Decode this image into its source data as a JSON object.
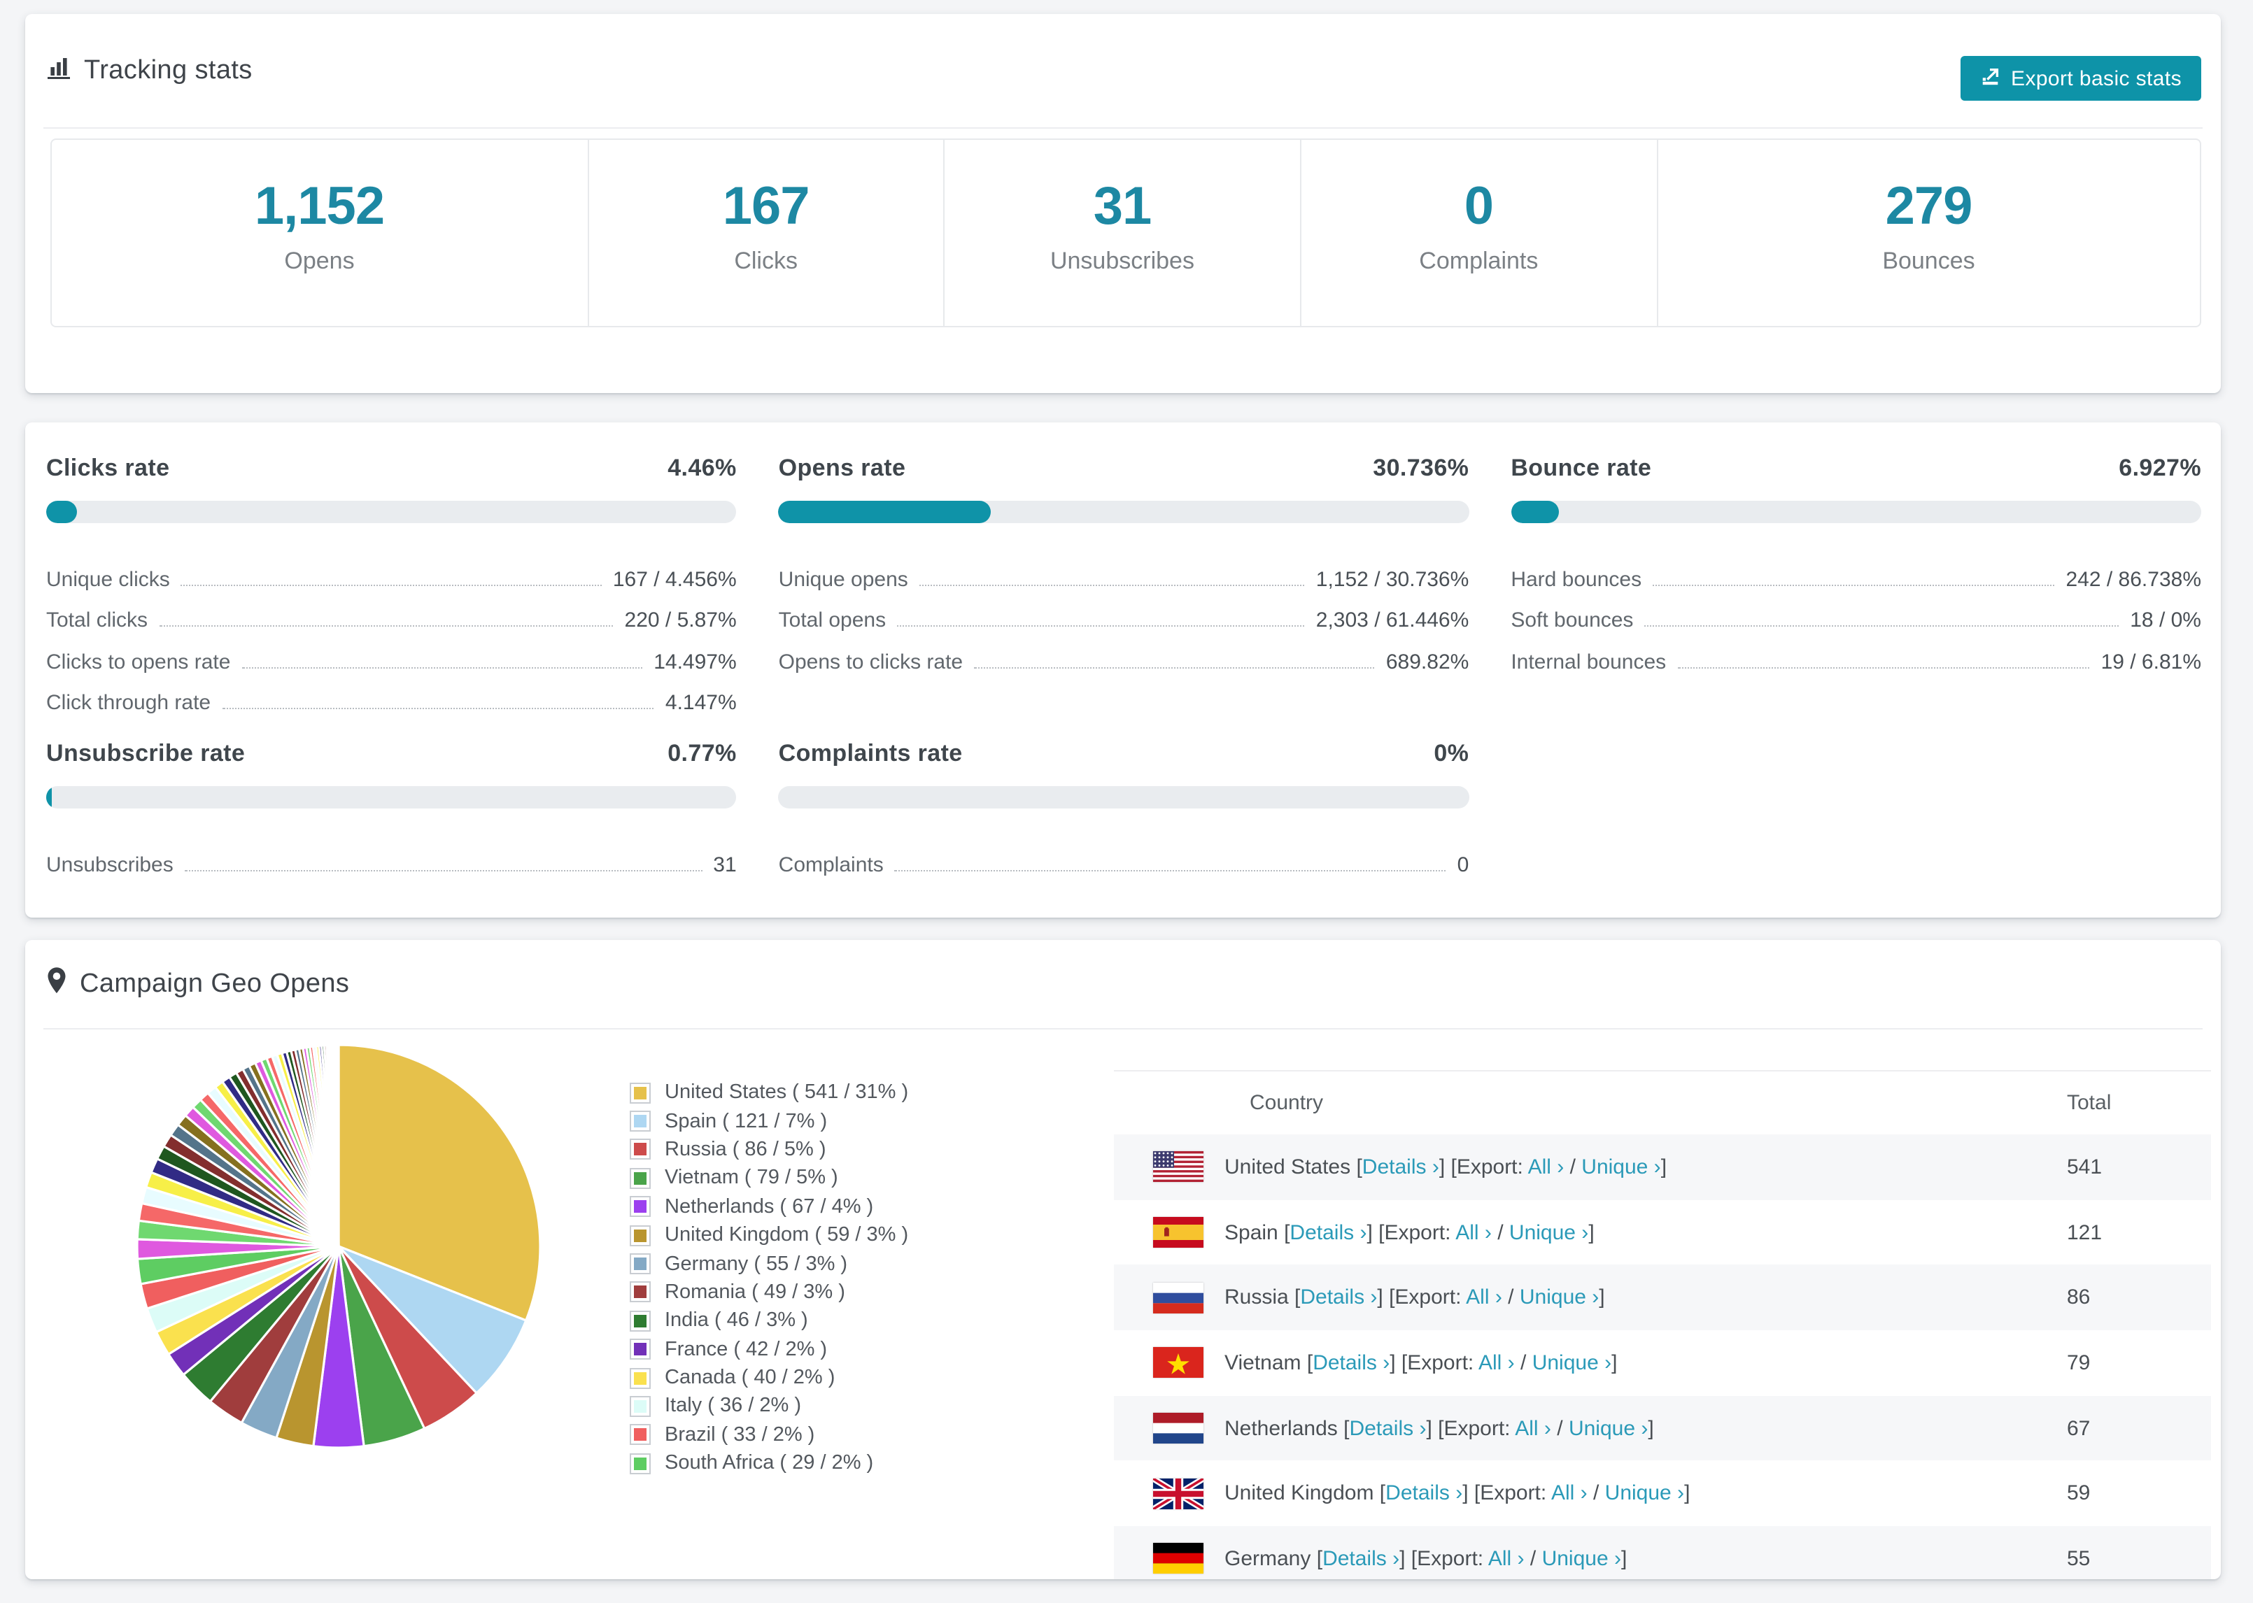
{
  "colors": {
    "page_bg": "#f4f5f7",
    "accent_number": "#1d88a3",
    "button_teal": "#0e93a8",
    "bar_fill": "#0f93a8",
    "link_teal": "#2b9ab8",
    "stripe": "#f6f7f9"
  },
  "tracking": {
    "title": "Tracking stats",
    "icon": "bar-chart-icon",
    "export_button": "Export basic stats",
    "stats": [
      {
        "value": "1,152",
        "label": "Opens"
      },
      {
        "value": "167",
        "label": "Clicks"
      },
      {
        "value": "31",
        "label": "Unsubscribes"
      },
      {
        "value": "0",
        "label": "Complaints"
      },
      {
        "value": "279",
        "label": "Bounces"
      }
    ]
  },
  "rates": {
    "sections": [
      {
        "title": "Clicks rate",
        "value": "4.46%",
        "pct": 4.46,
        "rows": [
          {
            "label": "Unique clicks",
            "value": "167 / 4.456%"
          },
          {
            "label": "Total clicks",
            "value": "220 / 5.87%"
          },
          {
            "label": "Clicks to opens rate",
            "value": "14.497%"
          },
          {
            "label": "Click through rate",
            "value": "4.147%"
          }
        ]
      },
      {
        "title": "Opens rate",
        "value": "30.736%",
        "pct": 30.736,
        "rows": [
          {
            "label": "Unique opens",
            "value": "1,152 / 30.736%"
          },
          {
            "label": "Total opens",
            "value": "2,303 / 61.446%"
          },
          {
            "label": "Opens to clicks rate",
            "value": "689.82%"
          }
        ]
      },
      {
        "title": "Bounce rate",
        "value": "6.927%",
        "pct": 6.927,
        "rows": [
          {
            "label": "Hard bounces",
            "value": "242 / 86.738%"
          },
          {
            "label": "Soft bounces",
            "value": "18 / 0%"
          },
          {
            "label": "Internal bounces",
            "value": "19 / 6.81%"
          }
        ]
      },
      {
        "title": "Unsubscribe rate",
        "value": "0.77%",
        "pct": 0.77,
        "rows": [
          {
            "label": "Unsubscribes",
            "value": "31"
          }
        ]
      },
      {
        "title": "Complaints rate",
        "value": "0%",
        "pct": 0,
        "rows": [
          {
            "label": "Complaints",
            "value": "0"
          }
        ]
      }
    ]
  },
  "geo": {
    "title": "Campaign Geo Opens",
    "icon": "map-pin-icon",
    "table": {
      "headers": [
        "Country",
        "Total"
      ],
      "tokens": {
        "lb": "[",
        "rb": "]",
        "slash": "/",
        "export_prefix": "Export:",
        "details": "Details ›",
        "all": "All ›",
        "unique": "Unique ›"
      },
      "rows": [
        {
          "country": "United States",
          "flag": "us",
          "total": "541"
        },
        {
          "country": "Spain",
          "flag": "es",
          "total": "121"
        },
        {
          "country": "Russia",
          "flag": "ru",
          "total": "86"
        },
        {
          "country": "Vietnam",
          "flag": "vn",
          "total": "79"
        },
        {
          "country": "Netherlands",
          "flag": "nl",
          "total": "67"
        },
        {
          "country": "United Kingdom",
          "flag": "gb",
          "total": "59"
        },
        {
          "country": "Germany",
          "flag": "de",
          "total": "55"
        }
      ]
    }
  },
  "chart_data": {
    "type": "pie",
    "title": "Campaign Geo Opens",
    "unit": "opens",
    "legend_position": "right",
    "start_angle_deg": -90,
    "direction": "clockwise",
    "slices": [
      {
        "name": "United States",
        "value": 541,
        "pct": 31,
        "color": "#e6c14b"
      },
      {
        "name": "Spain",
        "value": 121,
        "pct": 7,
        "color": "#aed7f2"
      },
      {
        "name": "Russia",
        "value": 86,
        "pct": 5,
        "color": "#cd4b4b"
      },
      {
        "name": "Vietnam",
        "value": 79,
        "pct": 5,
        "color": "#4aa44a"
      },
      {
        "name": "Netherlands",
        "value": 67,
        "pct": 4,
        "color": "#9c40ef"
      },
      {
        "name": "United Kingdom",
        "value": 59,
        "pct": 3,
        "color": "#b9952f"
      },
      {
        "name": "Germany",
        "value": 55,
        "pct": 3,
        "color": "#84a9c5"
      },
      {
        "name": "Romania",
        "value": 49,
        "pct": 3,
        "color": "#a03d3d"
      },
      {
        "name": "India",
        "value": 46,
        "pct": 3,
        "color": "#2e7c31"
      },
      {
        "name": "France",
        "value": 42,
        "pct": 2,
        "color": "#7230b8"
      },
      {
        "name": "Canada",
        "value": 40,
        "pct": 2,
        "color": "#fae14e"
      },
      {
        "name": "Italy",
        "value": 36,
        "pct": 2,
        "color": "#dcfcf7"
      },
      {
        "name": "Brazil",
        "value": 33,
        "pct": 2,
        "color": "#f05f5f"
      },
      {
        "name": "South Africa",
        "value": 29,
        "pct": 2,
        "color": "#5ecd62"
      }
    ],
    "others": {
      "pct": 26,
      "description": "remaining opens split across many small unlabeled country slices"
    },
    "tail_palette": [
      "#df59df",
      "#6fd870",
      "#f56868",
      "#e8fcff",
      "#f7ef48",
      "#312b85",
      "#1f571f",
      "#832e2e",
      "#54748a",
      "#85701f"
    ]
  }
}
